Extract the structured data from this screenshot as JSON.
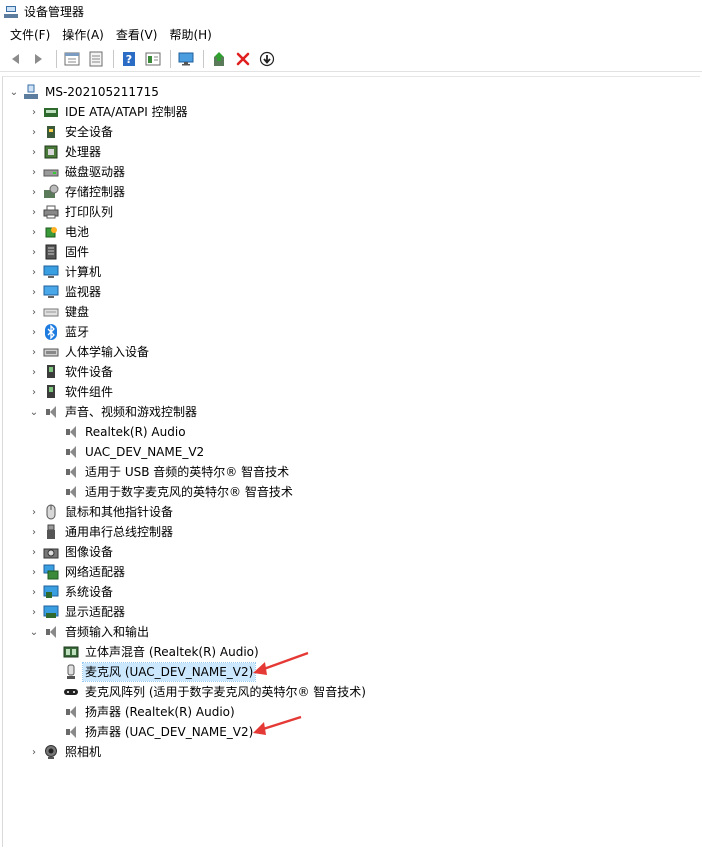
{
  "window": {
    "title": "设备管理器"
  },
  "menu": [
    "文件(F)",
    "操作(A)",
    "查看(V)",
    "帮助(H)"
  ],
  "toolbar": {
    "icons": [
      "back-icon",
      "forward-icon",
      "properties-icon",
      "show-hidden-icon",
      "help-icon",
      "view-icon",
      "monitor-icon",
      "update-driver-icon",
      "uninstall-icon",
      "disable-icon"
    ]
  },
  "tree": {
    "root": "MS-202105211715",
    "categories": [
      {
        "label": "IDE ATA/ATAPI 控制器",
        "icon": "ide-controller-icon"
      },
      {
        "label": "安全设备",
        "icon": "security-device-icon"
      },
      {
        "label": "处理器",
        "icon": "processor-icon"
      },
      {
        "label": "磁盘驱动器",
        "icon": "disk-drive-icon"
      },
      {
        "label": "存储控制器",
        "icon": "storage-controller-icon"
      },
      {
        "label": "打印队列",
        "icon": "printer-icon"
      },
      {
        "label": "电池",
        "icon": "battery-icon"
      },
      {
        "label": "固件",
        "icon": "firmware-icon"
      },
      {
        "label": "计算机",
        "icon": "computer-icon"
      },
      {
        "label": "监视器",
        "icon": "monitor-icon"
      },
      {
        "label": "键盘",
        "icon": "keyboard-icon"
      },
      {
        "label": "蓝牙",
        "icon": "bluetooth-icon"
      },
      {
        "label": "人体学输入设备",
        "icon": "hid-icon"
      },
      {
        "label": "软件设备",
        "icon": "software-device-icon"
      },
      {
        "label": "软件组件",
        "icon": "software-component-icon"
      },
      {
        "label": "声音、视频和游戏控制器",
        "icon": "speaker-icon",
        "expanded": true,
        "children": [
          "Realtek(R) Audio",
          "UAC_DEV_NAME_V2",
          "适用于 USB 音频的英特尔® 智音技术",
          "适用于数字麦克风的英特尔® 智音技术"
        ]
      },
      {
        "label": "鼠标和其他指针设备",
        "icon": "mouse-icon"
      },
      {
        "label": "通用串行总线控制器",
        "icon": "usb-icon"
      },
      {
        "label": "图像设备",
        "icon": "camera-icon"
      },
      {
        "label": "网络适配器",
        "icon": "network-adapter-icon"
      },
      {
        "label": "系统设备",
        "icon": "system-device-icon"
      },
      {
        "label": "显示适配器",
        "icon": "display-adapter-icon"
      },
      {
        "label": "音频输入和输出",
        "icon": "speaker-icon",
        "expanded": true,
        "children": [
          "立体声混音 (Realtek(R) Audio)",
          "麦克风 (UAC_DEV_NAME_V2)",
          "麦克风阵列 (适用于数字麦克风的英特尔® 智音技术)",
          "扬声器 (Realtek(R) Audio)",
          "扬声器 (UAC_DEV_NAME_V2)"
        ]
      },
      {
        "label": "照相机",
        "icon": "webcam-icon"
      }
    ]
  },
  "annotation_color": "#e53935",
  "highlight_color": "#cce8ff"
}
